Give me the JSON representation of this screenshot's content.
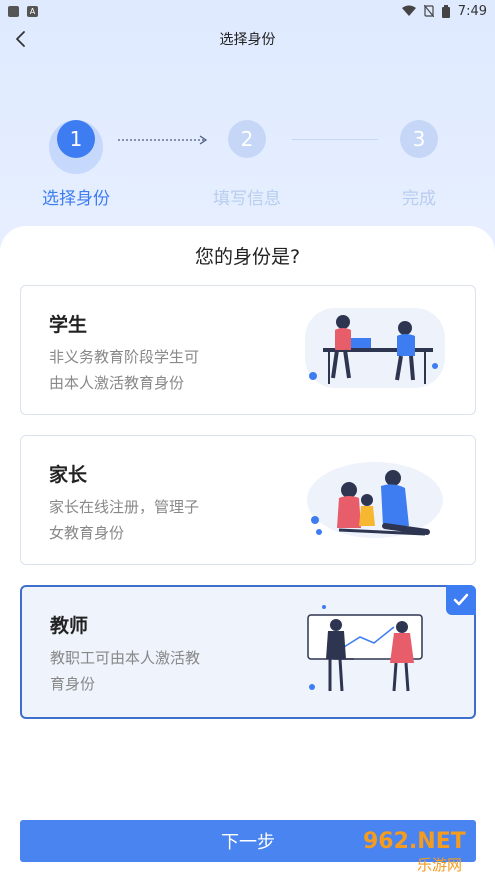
{
  "status_bar": {
    "time": "7:49",
    "left_icon_letter": "A"
  },
  "nav": {
    "title": "选择身份"
  },
  "steps": [
    {
      "number": "1",
      "label": "选择身份",
      "state": "active"
    },
    {
      "number": "2",
      "label": "填写信息",
      "state": "inactive"
    },
    {
      "number": "3",
      "label": "完成",
      "state": "inactive"
    }
  ],
  "question": "您的身份是?",
  "cards": [
    {
      "title": "学生",
      "desc_line1": "非义务教育阶段学生可",
      "desc_line2": "由本人激活教育身份",
      "selected": false
    },
    {
      "title": "家长",
      "desc_line1": "家长在线注册，管理子",
      "desc_line2": "女教育身份",
      "selected": false
    },
    {
      "title": "教师",
      "desc_line1": "教职工可由本人激活教",
      "desc_line2": "育身份",
      "selected": true
    }
  ],
  "next_button": "下一步",
  "watermark": {
    "brand": "962.NET",
    "site": "乐游网"
  },
  "colors": {
    "accent": "#3d7cf1",
    "inactive_step": "#c5d6f7",
    "selected_border": "#3f6fc9"
  }
}
